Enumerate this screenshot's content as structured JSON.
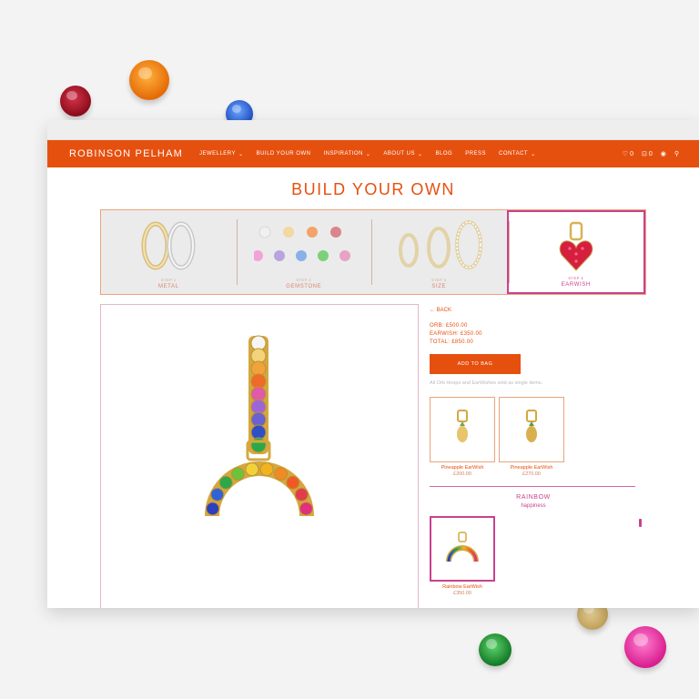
{
  "brand": "ROBINSON PELHAM",
  "nav": {
    "items": [
      {
        "label": "JEWELLERY",
        "dropdown": true
      },
      {
        "label": "BUILD YOUR OWN",
        "dropdown": false
      },
      {
        "label": "INSPIRATION",
        "dropdown": true
      },
      {
        "label": "ABOUT US",
        "dropdown": true
      },
      {
        "label": "BLOG",
        "dropdown": false
      },
      {
        "label": "PRESS",
        "dropdown": false
      },
      {
        "label": "CONTACT",
        "dropdown": true
      }
    ],
    "wishlist_count": "0",
    "bag_count": "0"
  },
  "page_title": "BUILD YOUR OWN",
  "steps": [
    {
      "num": "STEP 1",
      "name": "METAL"
    },
    {
      "num": "STEP 2",
      "name": "GEMSTONE"
    },
    {
      "num": "STEP 3",
      "name": "SIZE"
    },
    {
      "num": "STEP 4",
      "name": "EARWISH"
    }
  ],
  "side": {
    "back": "← BACK",
    "orb_price": "ORB: £500.00",
    "earwish_price": "EARWISH: £350.00",
    "total_price": "TOTAL: £850.00",
    "add_button": "ADD TO BAG",
    "note": "All Orb Hoops and EarWishes sold as single items."
  },
  "products": [
    {
      "name": "Pineapple EarWish",
      "price": "£200.00"
    },
    {
      "name": "Pineapple EarWish",
      "price": "£270.00"
    }
  ],
  "category": {
    "title": "RAINBOW",
    "subtitle": "happiness"
  },
  "selected_product": {
    "name": "Rainbow EarWish",
    "price": "£350.00"
  },
  "colors": {
    "brand_orange": "#e6500f",
    "accent_pink": "#c9418c"
  }
}
